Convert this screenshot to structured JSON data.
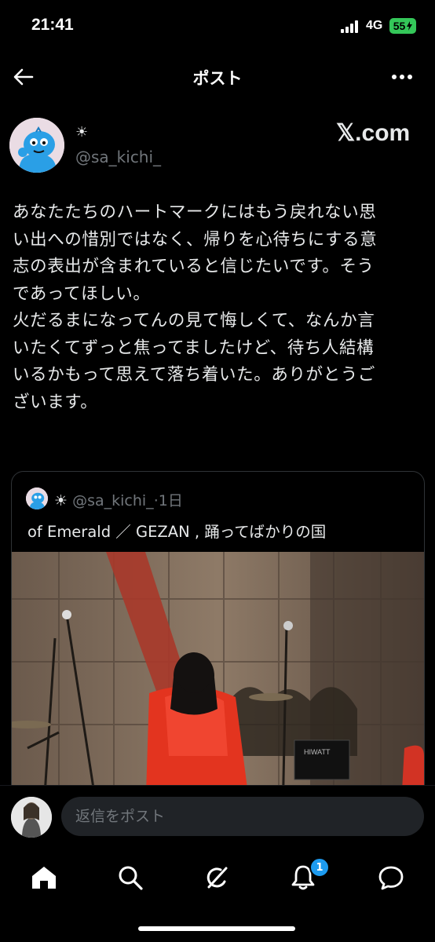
{
  "status_bar": {
    "time": "21:41",
    "network": "4G",
    "battery": "55",
    "icons": [
      "signal-bars-icon",
      "battery-charging-icon"
    ]
  },
  "header": {
    "title": "ポスト",
    "icons": [
      "back-arrow-icon",
      "more-options-icon"
    ]
  },
  "author": {
    "name": "☀",
    "handle": "@sa_kichi_",
    "avatar_icon": "cartoon-character-avatar"
  },
  "watermark": "𝕏.com",
  "post": {
    "lines": [
      "あなたたちのハートマークにはもう戻れない思",
      "い出への惜別ではなく、帰りを心待ちにする意",
      "志の表出が含まれていると信じたいです。そう",
      "であってほしい。",
      "火だるまになってんの見て悔しくて、なんか言",
      "いたくてずっと焦ってましたけど、待ち人結構",
      "いるかもって思えて落ち着いた。ありがとうご",
      "ざいます。"
    ]
  },
  "quote": {
    "name": "☀",
    "handle": "@sa_kichi_",
    "time": "·1日",
    "text": "of Emerald ／ GEZAN , 踊ってばかりの国",
    "media_icon": "concert-stage-photo",
    "amp_label": "HIWATT"
  },
  "reply": {
    "placeholder": "返信をポスト"
  },
  "nav": {
    "items": [
      "home-icon",
      "search-icon",
      "grok-icon",
      "notifications-icon",
      "messages-icon"
    ],
    "notification_count": "1"
  },
  "colors": {
    "background": "#000000",
    "text": "#e7e9ea",
    "muted": "#71767b",
    "accent": "#1d9bf0",
    "battery": "#34c759"
  }
}
